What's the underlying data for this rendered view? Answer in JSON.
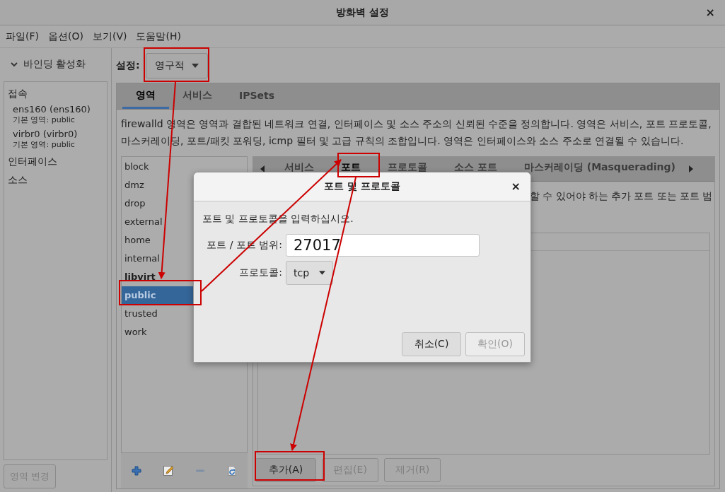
{
  "window": {
    "title": "방화벽 설정",
    "close": "×"
  },
  "menu": [
    "파일(F)",
    "옵션(O)",
    "보기(V)",
    "도움말(H)"
  ],
  "sidebar": {
    "binding": {
      "label": "바인딩 활성화",
      "expanded": true
    },
    "sections": [
      {
        "heading": "접속",
        "items": [
          {
            "name": "ens160 (ens160)",
            "zone_label": "기본 영역:",
            "zone": "public"
          },
          {
            "name": "virbr0 (virbr0)",
            "zone_label": "기본 영역:",
            "zone": "public"
          }
        ]
      },
      {
        "heading": "인터페이스"
      },
      {
        "heading": "소스"
      }
    ],
    "change_zone": {
      "label": "영역 변경",
      "disabled": true
    }
  },
  "configuration": {
    "label": "설정:",
    "value": "영구적"
  },
  "main_tabs": [
    {
      "label": "영역",
      "selected": true
    },
    {
      "label": "서비스",
      "selected": false
    },
    {
      "label": "IPSets",
      "selected": false
    }
  ],
  "zone_description": "firewalld 영역은 영역과 결합된 네트워크 연결, 인터페이스 및 소스 주소의 신뢰된 수준을 정의합니다. 영역은 서비스, 포트 프로토콜, 마스커레이딩, 포트/패킷 포워딩, icmp 필터 및 고급 규칙의 조합입니다. 영역은 인터페이스와 소스 주소로 연결될 수 있습니다.",
  "zones": [
    {
      "name": "block",
      "selected": false,
      "active": false
    },
    {
      "name": "dmz",
      "selected": false,
      "active": false
    },
    {
      "name": "drop",
      "selected": false,
      "active": false
    },
    {
      "name": "external",
      "selected": false,
      "active": false
    },
    {
      "name": "home",
      "selected": false,
      "active": false
    },
    {
      "name": "internal",
      "selected": false,
      "active": false
    },
    {
      "name": "libvirt",
      "selected": false,
      "active": true
    },
    {
      "name": "public",
      "selected": true,
      "active": false
    },
    {
      "name": "trusted",
      "selected": false,
      "active": false
    },
    {
      "name": "work",
      "selected": false,
      "active": false
    }
  ],
  "zone_tabs": [
    {
      "label": "서비스",
      "selected": false
    },
    {
      "label": "포트",
      "selected": true
    },
    {
      "label": "프로토콜",
      "selected": false
    },
    {
      "label": "소스 포트",
      "selected": false
    },
    {
      "label": "마스커레이딩 (Masquerading)",
      "selected": false
    }
  ],
  "ports_hint": "할 수 있어야 하는 추가 포트 또는 포트 범",
  "port_buttons": [
    {
      "label": "추가(A)",
      "disabled": false
    },
    {
      "label": "편집(E)",
      "disabled": true
    },
    {
      "label": "제거(R)",
      "disabled": true
    }
  ],
  "dialog": {
    "title": "포트 및 프로토콜",
    "close": "×",
    "prompt": "포트 및 프로토콜을 입력하십시오.",
    "port_label": "포트 / 포트 범위:",
    "port_value": "27017",
    "protocol_label": "프로토콜:",
    "protocol_value": "tcp",
    "buttons": [
      {
        "label": "취소(C)",
        "disabled": false
      },
      {
        "label": "확인(O)",
        "disabled": true
      }
    ]
  }
}
